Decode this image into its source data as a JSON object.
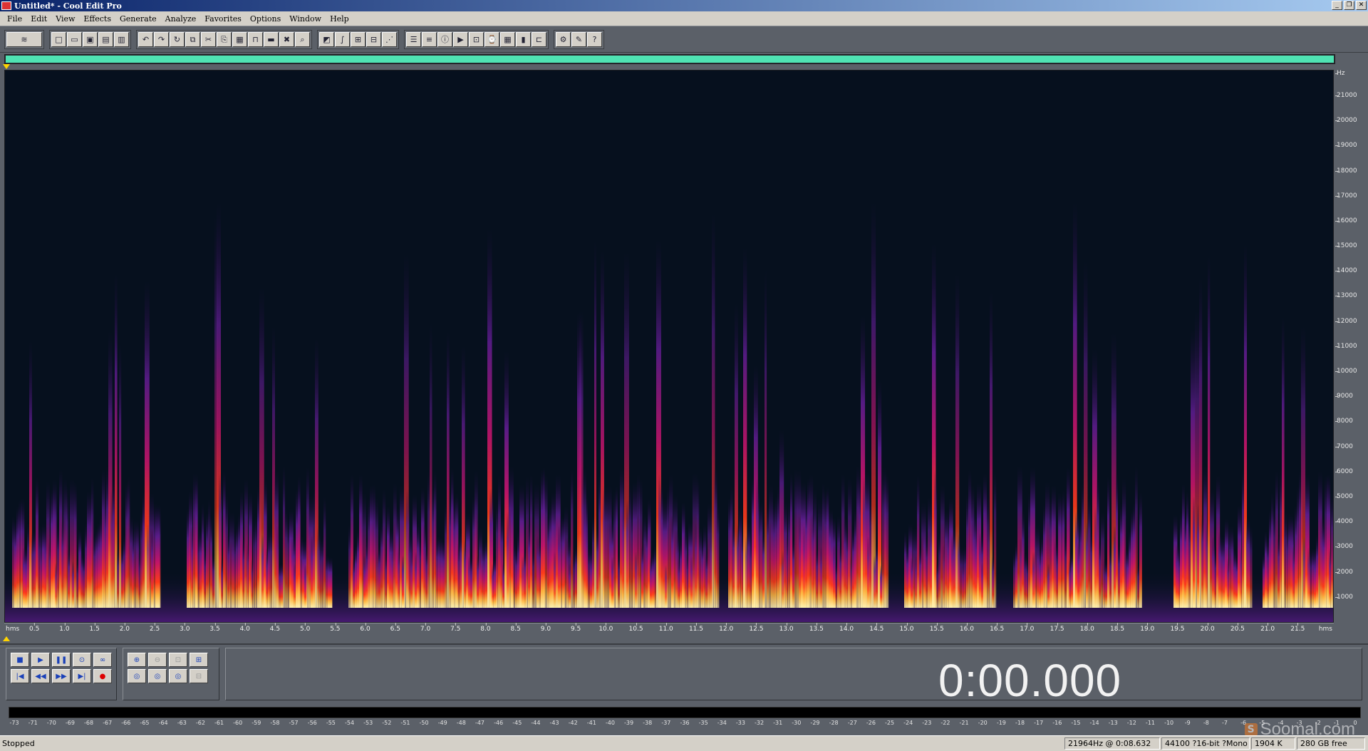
{
  "window": {
    "title": "Untitled* - Cool Edit Pro",
    "minimize": "_",
    "restore": "❐",
    "close": "✕"
  },
  "menu": [
    "File",
    "Edit",
    "View",
    "Effects",
    "Generate",
    "Analyze",
    "Favorites",
    "Options",
    "Window",
    "Help"
  ],
  "toolbar": {
    "groups": [
      [
        "waveform-view-icon"
      ],
      [
        "new-file-icon",
        "open-file-icon",
        "save-icon",
        "save-as-icon",
        "close-file-icon"
      ],
      [
        "undo-icon",
        "redo-icon",
        "repeat-icon",
        "mix-paste-icon",
        "cut-icon",
        "copy-icon",
        "paste-icon",
        "trim-icon",
        "silence-icon",
        "delete-icon",
        "zoom-selection-icon"
      ],
      [
        "spectral-view-icon",
        "envelope-icon",
        "amplify-icon",
        "normalize-icon",
        "fade-icon"
      ],
      [
        "cue-list-icon",
        "play-list-icon",
        "info-icon",
        "play-icon",
        "zoom-full-icon",
        "time-format-icon",
        "grid-icon",
        "meters-icon",
        "snap-icon"
      ],
      [
        "settings-icon",
        "tools-icon",
        "help-icon"
      ]
    ]
  },
  "spectrogram": {
    "freq_unit": "Hz",
    "freq_labels": [
      "21000",
      "20000",
      "19000",
      "18000",
      "17000",
      "16000",
      "15000",
      "14000",
      "13000",
      "12000",
      "11000",
      "10000",
      "9000",
      "8000",
      "7000",
      "6000",
      "5000",
      "4000",
      "3000",
      "2000",
      "1000"
    ],
    "time_labels": [
      "0.5",
      "1.0",
      "1.5",
      "2.0",
      "2.5",
      "3.0",
      "3.5",
      "4.0",
      "4.5",
      "5.0",
      "5.5",
      "6.0",
      "6.5",
      "7.0",
      "7.5",
      "8.0",
      "8.5",
      "9.0",
      "9.5",
      "10.0",
      "10.5",
      "11.0",
      "11.5",
      "12.0",
      "12.5",
      "13.0",
      "13.5",
      "14.0",
      "14.5",
      "15.0",
      "15.5",
      "16.0",
      "16.5",
      "17.0",
      "17.5",
      "18.0",
      "18.5",
      "19.0",
      "19.5",
      "20.0",
      "20.5",
      "21.0",
      "21.5"
    ],
    "time_unit": "hms",
    "time_max": 22.1
  },
  "transport": {
    "time_display": "0:00.000"
  },
  "meter": {
    "labels": [
      "-73",
      "-71",
      "-70",
      "-69",
      "-68",
      "-67",
      "-66",
      "-65",
      "-64",
      "-63",
      "-62",
      "-61",
      "-60",
      "-59",
      "-58",
      "-57",
      "-56",
      "-55",
      "-54",
      "-53",
      "-52",
      "-51",
      "-50",
      "-49",
      "-48",
      "-47",
      "-46",
      "-45",
      "-44",
      "-43",
      "-42",
      "-41",
      "-40",
      "-39",
      "-38",
      "-37",
      "-36",
      "-35",
      "-34",
      "-33",
      "-32",
      "-31",
      "-30",
      "-29",
      "-28",
      "-27",
      "-26",
      "-25",
      "-24",
      "-23",
      "-22",
      "-21",
      "-20",
      "-19",
      "-18",
      "-17",
      "-16",
      "-15",
      "-14",
      "-13",
      "-12",
      "-11",
      "-10",
      "-9",
      "-8",
      "-7",
      "-6",
      "-5",
      "-4",
      "-3",
      "-2",
      "-1",
      "0"
    ]
  },
  "watermark": {
    "logo": "S",
    "text": "Soomal.com"
  },
  "status": {
    "state": "Stopped",
    "position": "21964Hz @  0:08.632",
    "format": "44100 ?16-bit ?Mono",
    "size": "1904 K",
    "free": "280 GB free"
  },
  "colors": {
    "overview": "#4fe3b3",
    "spectrogram_bg": "#06101e",
    "hot": "#fff3b0",
    "warm": "#ff3b1a",
    "mid": "#c0146a",
    "cool": "#5a1c8a"
  }
}
